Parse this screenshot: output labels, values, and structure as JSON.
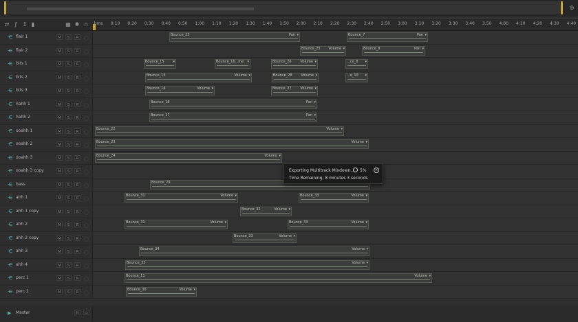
{
  "ruler": {
    "ticks": [
      "hms",
      "0:10",
      "0:20",
      "0:30",
      "0:40",
      "0:50",
      "1:00",
      "1:10",
      "1:20",
      "1:30",
      "1:40",
      "1:50",
      "2:00",
      "2:10",
      "2:20",
      "2:30",
      "2:40",
      "2:50",
      "3:00",
      "3:10",
      "3:20",
      "3:30",
      "3:40",
      "3:50",
      "4:00",
      "4:10",
      "4:20",
      "4:30",
      "4:40"
    ]
  },
  "track_buttons": {
    "mute": "M",
    "solo": "S",
    "record": "R"
  },
  "tracks": [
    {
      "name": "flair 1",
      "clips": [
        {
          "label": "Bounce_25",
          "fx": "Pan"
        },
        {
          "label": "Bounce_7",
          "fx": "Pan"
        }
      ]
    },
    {
      "name": "flair 2",
      "clips": [
        {
          "label": "Bounce_25",
          "fx": "Volume"
        },
        {
          "label": "Bounce_8",
          "fx": "Pan"
        }
      ]
    },
    {
      "name": "bits 1",
      "clips": [
        {
          "label": "Bounce_15",
          "fx": ""
        },
        {
          "label": "Bounce_16...me",
          "fx": ""
        },
        {
          "label": "Bounce_26",
          "fx": "Volume"
        },
        {
          "label": "...ce_8",
          "fx": ""
        }
      ]
    },
    {
      "name": "bits 2",
      "clips": [
        {
          "label": "Bounce_13",
          "fx": "Volume"
        },
        {
          "label": "Bounce_28",
          "fx": "Volume"
        },
        {
          "label": "...e_10",
          "fx": ""
        }
      ]
    },
    {
      "name": "bits 3",
      "clips": [
        {
          "label": "Bounce_14",
          "fx": "Volume"
        },
        {
          "label": "Bounce_27",
          "fx": "Volume"
        }
      ]
    },
    {
      "name": "hahh 1",
      "clips": [
        {
          "label": "Bounce_18",
          "fx": "Pan"
        }
      ]
    },
    {
      "name": "hahh 2",
      "clips": [
        {
          "label": "Bounce_17",
          "fx": "Pan"
        }
      ]
    },
    {
      "name": "ooahh 1",
      "clips": [
        {
          "label": "Bounce_22",
          "fx": "Volume"
        }
      ]
    },
    {
      "name": "ooahh 2",
      "clips": [
        {
          "label": "Bounce_23",
          "fx": "Volume"
        }
      ]
    },
    {
      "name": "ooahh 3",
      "clips": [
        {
          "label": "Bounce_24",
          "fx": "Volume"
        }
      ]
    },
    {
      "name": "ooahh 3 copy",
      "clips": []
    },
    {
      "name": "bass",
      "clips": [
        {
          "label": "Bounce_29",
          "fx": "Volume"
        }
      ]
    },
    {
      "name": "ahh 1",
      "clips": [
        {
          "label": "Bounce_31",
          "fx": "Volume"
        },
        {
          "label": "Bounce_33",
          "fx": "Volume"
        }
      ]
    },
    {
      "name": "ahh 1 copy",
      "clips": [
        {
          "label": "Bounce_32",
          "fx": "Volume"
        }
      ]
    },
    {
      "name": "ahh 2",
      "clips": [
        {
          "label": "Bounce_31",
          "fx": "Volume"
        },
        {
          "label": "Bounce_33",
          "fx": "Volume"
        }
      ]
    },
    {
      "name": "ahh 2 copy",
      "clips": [
        {
          "label": "Bounce_33",
          "fx": "Volume"
        }
      ]
    },
    {
      "name": "ahh 3",
      "clips": [
        {
          "label": "Bounce_34",
          "fx": "Volume"
        }
      ]
    },
    {
      "name": "ahh 4",
      "clips": [
        {
          "label": "Bounce_35",
          "fx": "Volume"
        }
      ]
    },
    {
      "name": "perc 1",
      "clips": [
        {
          "label": "Bounce_11",
          "fx": "Volume"
        }
      ]
    },
    {
      "name": "perc 2",
      "clips": [
        {
          "label": "Bounce_30",
          "fx": "Volume"
        }
      ]
    }
  ],
  "master": {
    "name": "Master"
  },
  "export_popup": {
    "title": "Exporting Multitrack Mixdown...",
    "percent": "5%",
    "progress_fraction": 0.05,
    "remaining": "Time Remaining: 8 minutes 3 seconds"
  },
  "colors": {
    "track_icon": "#58b4b4",
    "playhead": "#c9a23a",
    "clip_body": "#3b3d3a"
  }
}
